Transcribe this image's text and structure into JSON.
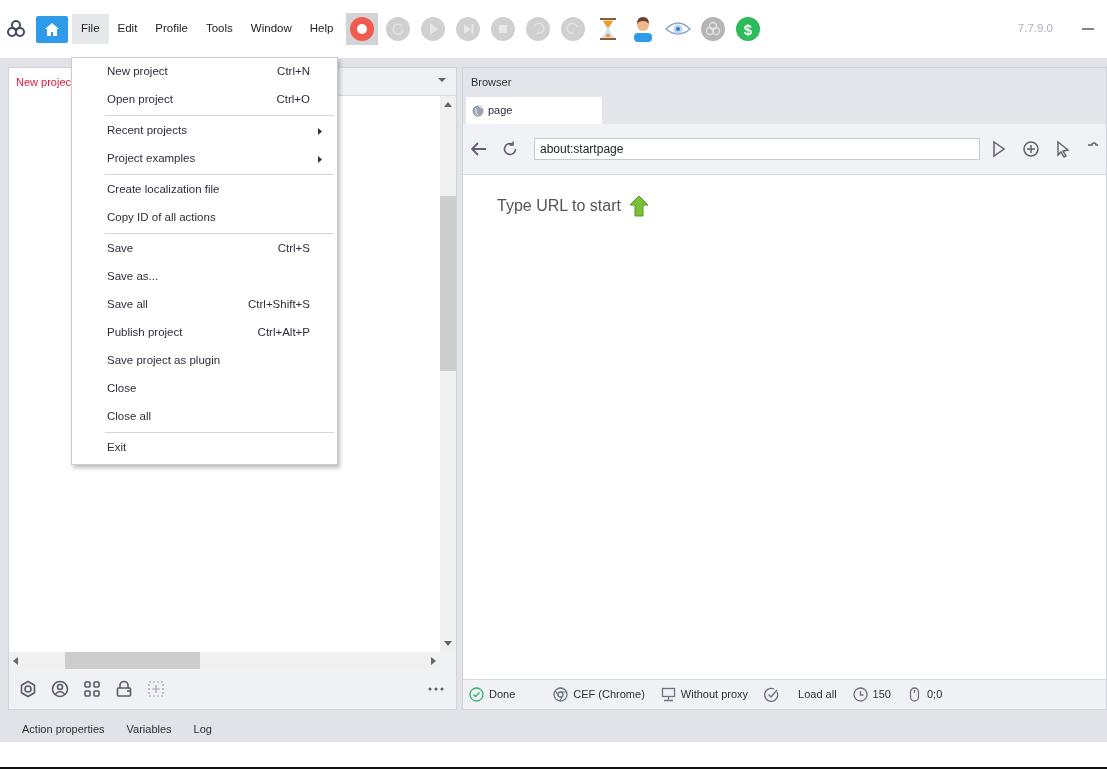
{
  "menu_bar": [
    {
      "label": "File",
      "selected": true
    },
    {
      "label": "Edit",
      "selected": false
    },
    {
      "label": "Profile",
      "selected": false
    },
    {
      "label": "Tools",
      "selected": false
    },
    {
      "label": "Window",
      "selected": false
    },
    {
      "label": "Help",
      "selected": false
    }
  ],
  "toolbar": [
    {
      "kind": "record",
      "disabled": false
    },
    {
      "kind": "restart",
      "disabled": true
    },
    {
      "kind": "play",
      "disabled": true
    },
    {
      "kind": "step",
      "disabled": true
    },
    {
      "kind": "stop",
      "disabled": true
    },
    {
      "kind": "undo",
      "disabled": true
    },
    {
      "kind": "redo",
      "disabled": true
    },
    {
      "kind": "hourglass",
      "disabled": false
    },
    {
      "kind": "person",
      "disabled": false
    },
    {
      "kind": "eye",
      "disabled": false
    },
    {
      "kind": "logo",
      "disabled": true
    },
    {
      "kind": "dollar",
      "disabled": false,
      "label": "$"
    }
  ],
  "version": "7.7.9.0",
  "file_menu": [
    [
      {
        "label": "New project",
        "shortcut": "Ctrl+N",
        "submenu": false
      },
      {
        "label": "Open project",
        "shortcut": "Ctrl+O",
        "submenu": false
      }
    ],
    [
      {
        "label": "Recent projects",
        "submenu": true
      },
      {
        "label": "Project examples",
        "submenu": true
      }
    ],
    [
      {
        "label": "Create localization file",
        "submenu": false
      },
      {
        "label": "Copy ID of all actions",
        "submenu": false
      }
    ],
    [
      {
        "label": "Save",
        "shortcut": "Ctrl+S",
        "submenu": false
      },
      {
        "label": "Save as...",
        "submenu": false
      },
      {
        "label": "Save all",
        "shortcut": "Ctrl+Shift+S",
        "submenu": false
      },
      {
        "label": "Publish project",
        "shortcut": "Ctrl+Alt+P",
        "submenu": false
      },
      {
        "label": "Save project as plugin",
        "submenu": false
      },
      {
        "label": "Close",
        "submenu": false
      },
      {
        "label": "Close all",
        "submenu": false
      }
    ],
    [
      {
        "label": "Exit",
        "submenu": false
      }
    ]
  ],
  "project_panel": {
    "tab": "New projec"
  },
  "bottom_tabs": [
    {
      "label": "Action properties",
      "selected": false
    },
    {
      "label": "Variables",
      "selected": false
    },
    {
      "label": "Log",
      "selected": false
    }
  ],
  "browser": {
    "title": "Browser",
    "tab": "page",
    "url": "about:startpage",
    "message": "Type URL to start",
    "status_bar": [
      {
        "kind": "done",
        "text": "Done"
      },
      {
        "kind": "engine",
        "text": "CEF (Chrome)"
      },
      {
        "kind": "proxy",
        "text": "Without proxy"
      },
      {
        "kind": "load",
        "text": "Load all"
      },
      {
        "kind": "clock",
        "text": "150"
      },
      {
        "kind": "mouse",
        "text": "0;0"
      }
    ]
  }
}
